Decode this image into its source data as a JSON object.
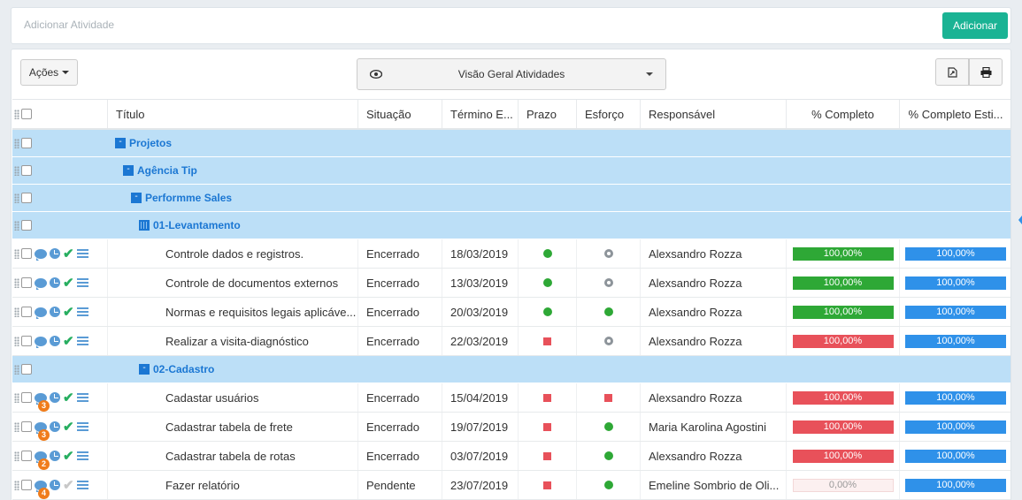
{
  "add_activity": {
    "placeholder": "Adicionar Atividade",
    "button_label": "Adicionar"
  },
  "toolbar": {
    "acoes_label": "Ações",
    "view_selected": "Visão Geral Atividades"
  },
  "columns": [
    "Título",
    "Situação",
    "Término E...",
    "Prazo",
    "Esforço",
    "Responsável",
    "% Completo",
    "% Completo Esti..."
  ],
  "groups": [
    {
      "label": "Projetos",
      "level": 0,
      "icon": "collapse-icon"
    },
    {
      "label": "Agência Tip",
      "level": 1,
      "icon": "collapse-icon"
    },
    {
      "label": "Performme Sales",
      "level": 2,
      "icon": "collapse-icon"
    },
    {
      "label": "01-Levantamento",
      "level": 3,
      "icon": "expand-grid-icon"
    },
    {
      "label": "02-Cadastro",
      "level": 3,
      "icon": "collapse-icon"
    }
  ],
  "tasks_levantamento": [
    {
      "title": "Controle dados e registros.",
      "situacao": "Encerrado",
      "termino": "18/03/2019",
      "prazo": "green-dot",
      "esforco": "gray-dot",
      "responsavel": "Alexsandro Rozza",
      "pc": "100,00%",
      "pc_color": "green",
      "pce": "100,00%",
      "comments": "",
      "done": true
    },
    {
      "title": "Controle de documentos externos",
      "situacao": "Encerrado",
      "termino": "13/03/2019",
      "prazo": "green-dot",
      "esforco": "gray-dot",
      "responsavel": "Alexsandro Rozza",
      "pc": "100,00%",
      "pc_color": "green",
      "pce": "100,00%",
      "comments": "",
      "done": true
    },
    {
      "title": "Normas e requisitos legais aplicáve...",
      "situacao": "Encerrado",
      "termino": "20/03/2019",
      "prazo": "green-dot",
      "esforco": "green-dot",
      "responsavel": "Alexsandro Rozza",
      "pc": "100,00%",
      "pc_color": "green",
      "pce": "100,00%",
      "comments": "",
      "done": true
    },
    {
      "title": "Realizar a visita-diagnóstico",
      "situacao": "Encerrado",
      "termino": "22/03/2019",
      "prazo": "red-square",
      "esforco": "gray-dot",
      "responsavel": "Alexsandro Rozza",
      "pc": "100,00%",
      "pc_color": "red",
      "pce": "100,00%",
      "comments": "",
      "done": true
    }
  ],
  "tasks_cadastro": [
    {
      "title": "Cadastar usuários",
      "situacao": "Encerrado",
      "termino": "15/04/2019",
      "prazo": "red-square",
      "esforco": "red-square",
      "responsavel": "Alexsandro Rozza",
      "pc": "100,00%",
      "pc_color": "red",
      "pce": "100,00%",
      "comments": "3",
      "done": true
    },
    {
      "title": "Cadastrar tabela de frete",
      "situacao": "Encerrado",
      "termino": "19/07/2019",
      "prazo": "red-square",
      "esforco": "green-dot",
      "responsavel": "Maria Karolina Agostini",
      "pc": "100,00%",
      "pc_color": "red",
      "pce": "100,00%",
      "comments": "3",
      "done": true
    },
    {
      "title": "Cadastrar tabela de rotas",
      "situacao": "Encerrado",
      "termino": "03/07/2019",
      "prazo": "red-square",
      "esforco": "green-dot",
      "responsavel": "Alexsandro Rozza",
      "pc": "100,00%",
      "pc_color": "red",
      "pce": "100,00%",
      "comments": "2",
      "done": true
    },
    {
      "title": "Fazer relatório",
      "situacao": "Pendente",
      "termino": "23/07/2019",
      "prazo": "red-square",
      "esforco": "green-dot",
      "responsavel": "Emeline Sombrio de Oli...",
      "pc": "0,00%",
      "pc_color": "empty",
      "pce": "100,00%",
      "comments": "4",
      "done": false
    }
  ],
  "colors": {
    "accent": "#1ab394",
    "group_bg": "#bcdff7",
    "link": "#1b77d3",
    "green": "#2ea836",
    "red": "#e8515a",
    "blue": "#2f91e9"
  }
}
